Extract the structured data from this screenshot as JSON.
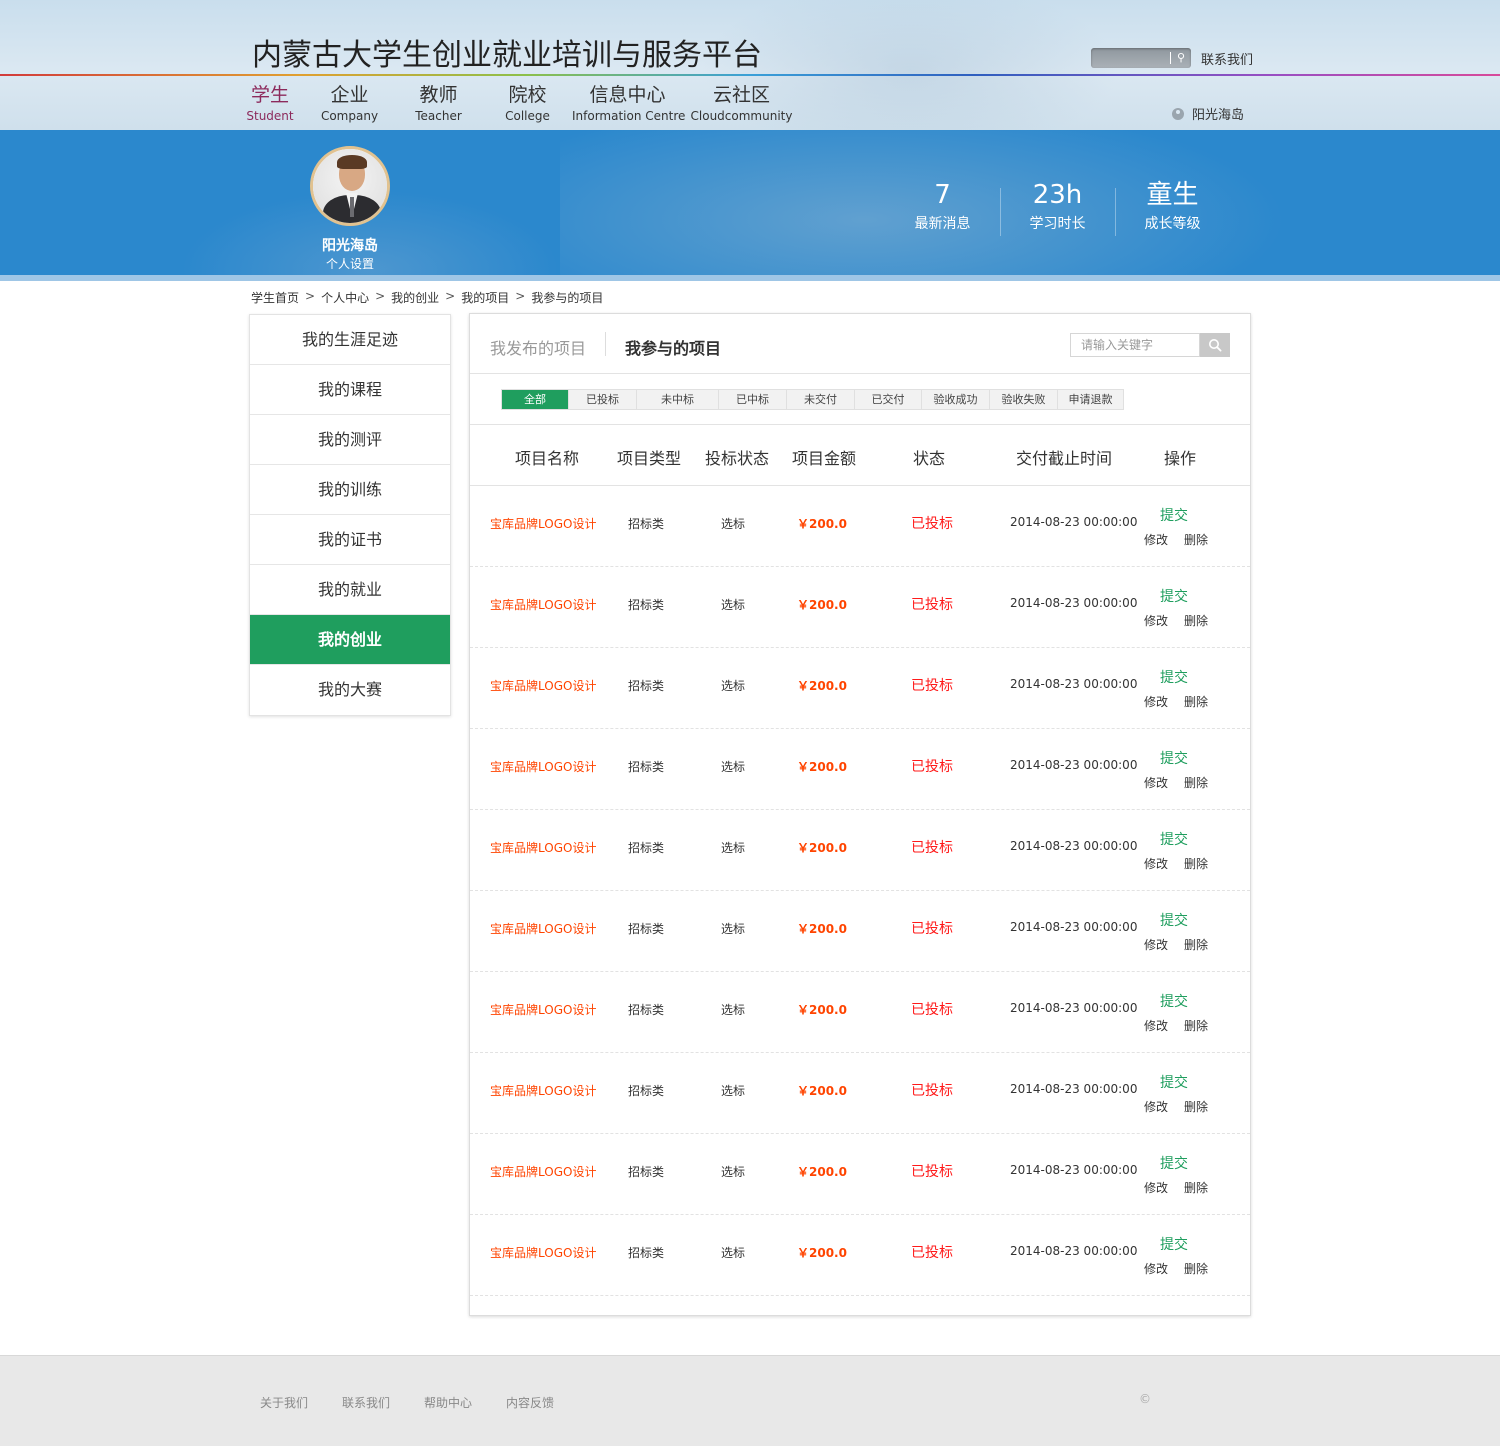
{
  "header": {
    "site_title": "内蒙古大学生创业就业培训与服务平台",
    "contact": "联系我们",
    "user_name": "阳光海岛",
    "search_icon": "search-icon"
  },
  "nav": [
    {
      "cn": "学生",
      "en": "Student",
      "active": true
    },
    {
      "cn": "企业",
      "en": "Company"
    },
    {
      "cn": "教师",
      "en": "Teacher"
    },
    {
      "cn": "院校",
      "en": "College"
    },
    {
      "cn": "信息中心",
      "en": "Information Centre"
    },
    {
      "cn": "云社区",
      "en": "Cloudcommunity"
    }
  ],
  "profile": {
    "name": "阳光海岛",
    "settings": "个人设置"
  },
  "stats": [
    {
      "value": "7",
      "label": "最新消息"
    },
    {
      "value": "23h",
      "label": "学习时长"
    },
    {
      "value": "童生",
      "label": "成长等级"
    }
  ],
  "breadcrumb": [
    "学生首页",
    "个人中心",
    "我的创业",
    "我的项目",
    "我参与的项目"
  ],
  "sidebar": [
    {
      "label": "我的生涯足迹"
    },
    {
      "label": "我的课程"
    },
    {
      "label": "我的测评"
    },
    {
      "label": "我的训练"
    },
    {
      "label": "我的证书"
    },
    {
      "label": "我的就业"
    },
    {
      "label": "我的创业",
      "active": true
    },
    {
      "label": "我的大赛"
    }
  ],
  "panel": {
    "tab_published": "我发布的项目",
    "tab_joined": "我参与的项目",
    "search_placeholder": "请输入关键字",
    "filters": [
      {
        "label": "全部",
        "active": true
      },
      {
        "label": "已投标"
      },
      {
        "label": "未中标"
      },
      {
        "label": "已中标"
      },
      {
        "label": "未交付"
      },
      {
        "label": "已交付"
      },
      {
        "label": "验收成功"
      },
      {
        "label": "验收失败"
      },
      {
        "label": "申请退款"
      }
    ],
    "columns": [
      "项目名称",
      "项目类型",
      "投标状态",
      "项目金额",
      "状态",
      "交付截止时间",
      "操作"
    ],
    "rows": [
      {
        "name": "宝库品牌LOGO设计",
        "type": "招标类",
        "bid": "选标",
        "amount": "￥200.0",
        "status": "已投标",
        "deadline": "2014-08-23 00:00:00"
      },
      {
        "name": "宝库品牌LOGO设计",
        "type": "招标类",
        "bid": "选标",
        "amount": "￥200.0",
        "status": "已投标",
        "deadline": "2014-08-23 00:00:00"
      },
      {
        "name": "宝库品牌LOGO设计",
        "type": "招标类",
        "bid": "选标",
        "amount": "￥200.0",
        "status": "已投标",
        "deadline": "2014-08-23 00:00:00"
      },
      {
        "name": "宝库品牌LOGO设计",
        "type": "招标类",
        "bid": "选标",
        "amount": "￥200.0",
        "status": "已投标",
        "deadline": "2014-08-23 00:00:00"
      },
      {
        "name": "宝库品牌LOGO设计",
        "type": "招标类",
        "bid": "选标",
        "amount": "￥200.0",
        "status": "已投标",
        "deadline": "2014-08-23 00:00:00"
      },
      {
        "name": "宝库品牌LOGO设计",
        "type": "招标类",
        "bid": "选标",
        "amount": "￥200.0",
        "status": "已投标",
        "deadline": "2014-08-23 00:00:00"
      },
      {
        "name": "宝库品牌LOGO设计",
        "type": "招标类",
        "bid": "选标",
        "amount": "￥200.0",
        "status": "已投标",
        "deadline": "2014-08-23 00:00:00"
      },
      {
        "name": "宝库品牌LOGO设计",
        "type": "招标类",
        "bid": "选标",
        "amount": "￥200.0",
        "status": "已投标",
        "deadline": "2014-08-23 00:00:00"
      },
      {
        "name": "宝库品牌LOGO设计",
        "type": "招标类",
        "bid": "选标",
        "amount": "￥200.0",
        "status": "已投标",
        "deadline": "2014-08-23 00:00:00"
      },
      {
        "name": "宝库品牌LOGO设计",
        "type": "招标类",
        "bid": "选标",
        "amount": "￥200.0",
        "status": "已投标",
        "deadline": "2014-08-23 00:00:00"
      }
    ],
    "actions": {
      "submit": "提交",
      "edit": "修改",
      "delete": "删除"
    }
  },
  "footer": {
    "links": [
      "关于我们",
      "联系我们",
      "帮助中心",
      "内容反馈"
    ],
    "copyright": "©"
  },
  "colors": {
    "accent_green": "#1f9e5e",
    "banner_blue": "#2b88cd",
    "price_orange": "#ff4400",
    "status_red": "#ff1a1a",
    "nav_active": "#8c2a5c"
  }
}
